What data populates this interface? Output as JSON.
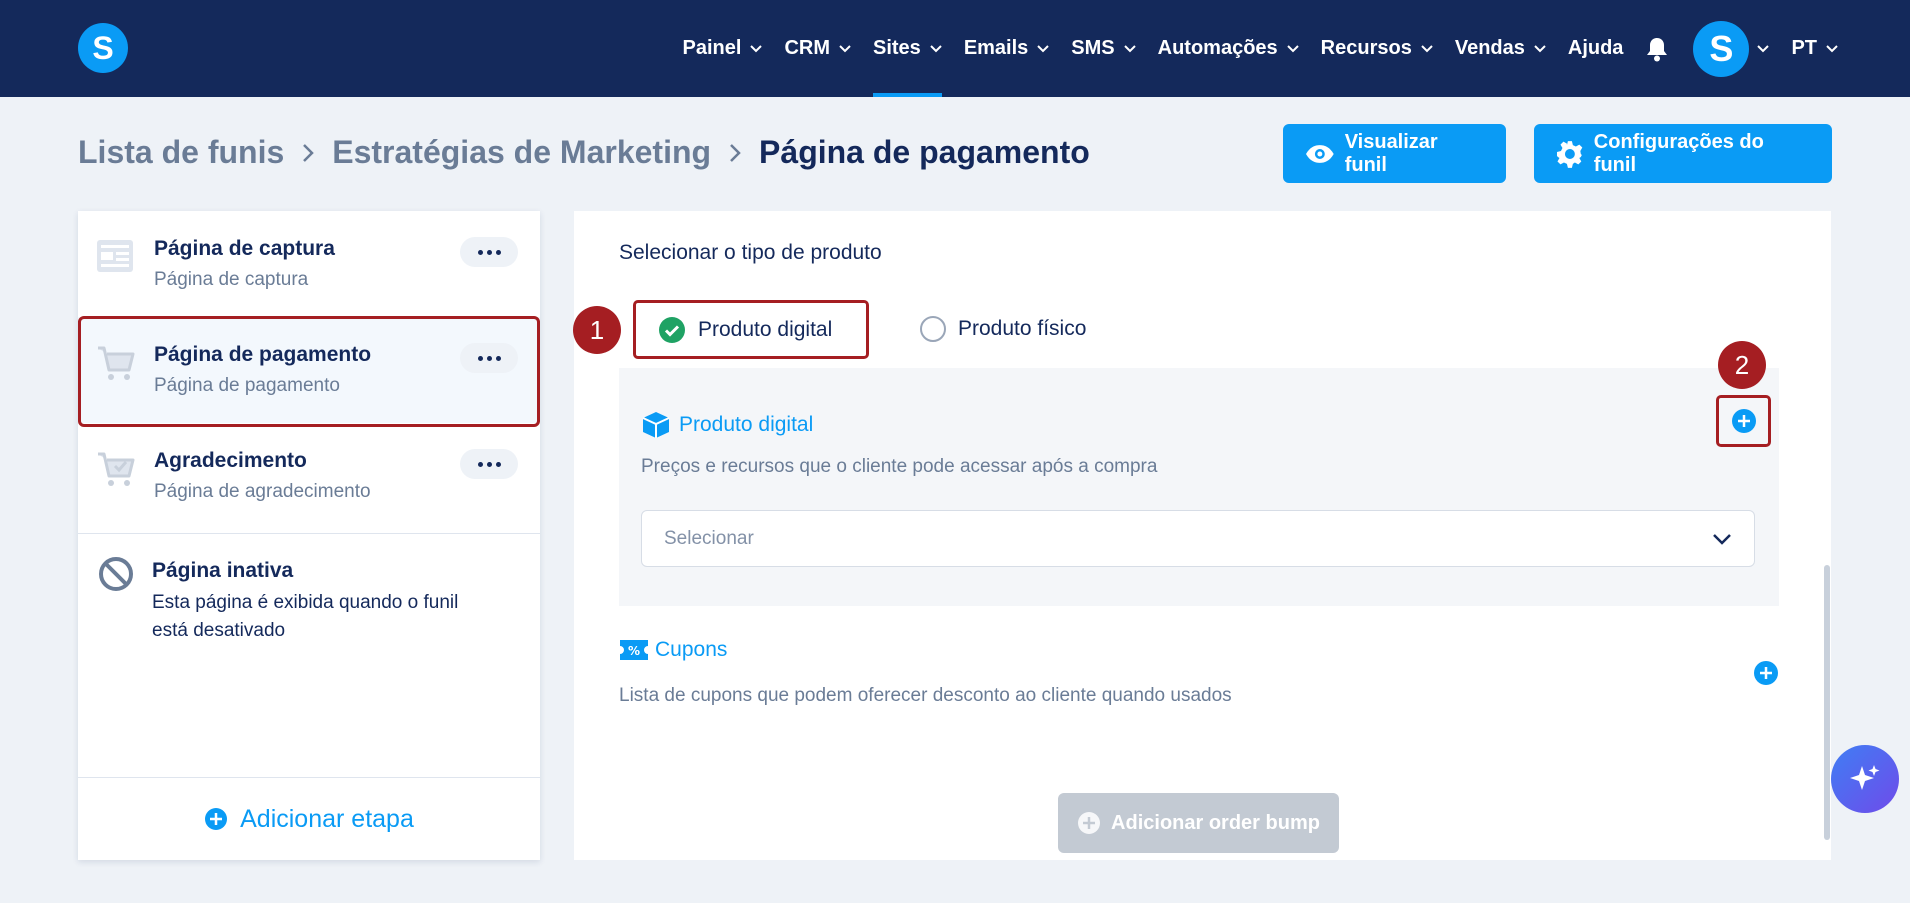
{
  "header": {
    "logo": "S",
    "nav": [
      {
        "label": "Painel"
      },
      {
        "label": "CRM"
      },
      {
        "label": "Sites"
      },
      {
        "label": "Emails"
      },
      {
        "label": "SMS"
      },
      {
        "label": "Automações"
      },
      {
        "label": "Recursos"
      },
      {
        "label": "Vendas"
      },
      {
        "label": "Ajuda"
      }
    ],
    "active_nav": "Sites",
    "avatar": "S",
    "language": "PT"
  },
  "breadcrumb": [
    "Lista de funis",
    "Estratégias de Marketing",
    "Página de pagamento"
  ],
  "actions": {
    "view_funnel": "Visualizar funil",
    "funnel_settings": "Configurações do funil"
  },
  "steps": [
    {
      "title": "Página de captura",
      "subtitle": "Página de captura",
      "icon": "landing-page-icon"
    },
    {
      "title": "Página de pagamento",
      "subtitle": "Página de pagamento",
      "icon": "cart-icon"
    },
    {
      "title": "Agradecimento",
      "subtitle": "Página de agradecimento",
      "icon": "cart-check-icon"
    }
  ],
  "inactive_page": {
    "title": "Página inativa",
    "description": "Esta página é exibida quando o funil está desativado"
  },
  "add_step": "Adicionar etapa",
  "product": {
    "select_type_label": "Selecionar o tipo de produto",
    "types": [
      "Produto digital",
      "Produto físico"
    ],
    "selected_type": "Produto digital",
    "section_title": "Produto digital",
    "section_desc": "Preços e recursos que o cliente pode acessar após a compra",
    "select_placeholder": "Selecionar"
  },
  "coupons": {
    "title": "Cupons",
    "desc": "Lista de cupons que podem oferecer desconto ao cliente quando usados"
  },
  "order_bump": "Adicionar order bump",
  "annotations": [
    "1",
    "2"
  ],
  "colors": {
    "nav_bg": "#14295b",
    "accent": "#0a9bf5",
    "highlight": "#a51e22",
    "page_bg": "#eef2f7"
  }
}
